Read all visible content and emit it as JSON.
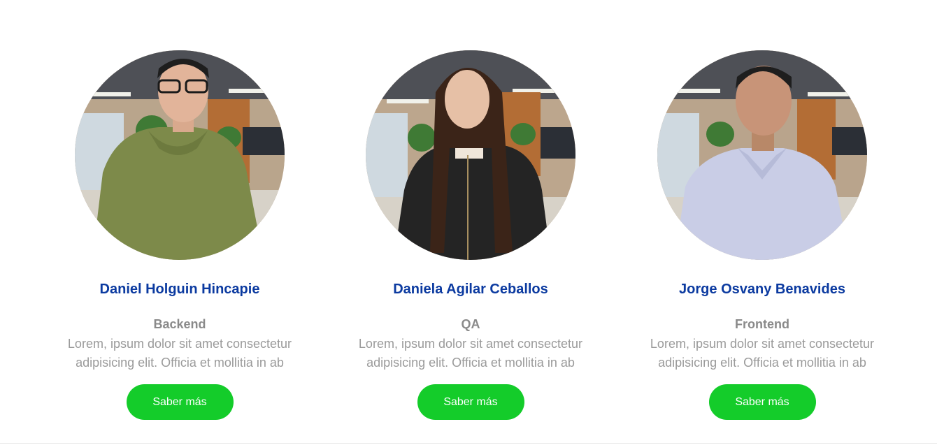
{
  "team": {
    "members": [
      {
        "name": "Daniel Holguin Hincapie",
        "role": "Backend",
        "description": "Lorem, ipsum dolor sit amet consectetur adipisicing elit. Officia et mollitia in ab",
        "button_label": "Saber más",
        "shirt_color": "#7d8a4a"
      },
      {
        "name": "Daniela Agilar Ceballos",
        "role": "QA",
        "description": "Lorem, ipsum dolor sit amet consectetur adipisicing elit. Officia et mollitia in ab",
        "button_label": "Saber más",
        "shirt_color": "#242424"
      },
      {
        "name": "Jorge Osvany Benavides",
        "role": "Frontend",
        "description": "Lorem, ipsum dolor sit amet consectetur adipisicing elit. Officia et mollitia in ab",
        "button_label": "Saber más",
        "shirt_color": "#c9cde6"
      }
    ]
  },
  "colors": {
    "name": "#0b3aa0",
    "role": "#8a8a8a",
    "description": "#9a9a9a",
    "button": "#14cc2a"
  }
}
